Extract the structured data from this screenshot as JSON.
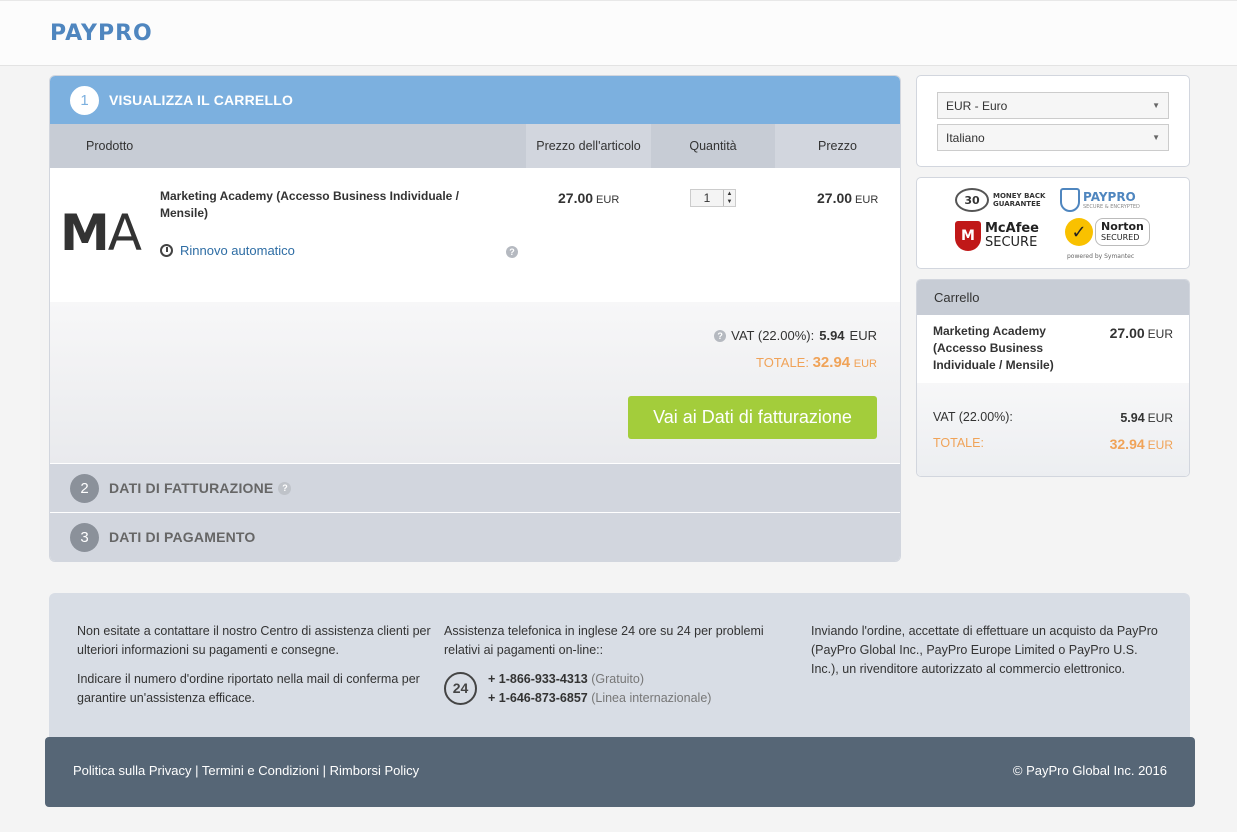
{
  "brand": {
    "logo": "PAYPRO",
    "color": "#4f86bf"
  },
  "steps": {
    "s1": {
      "num": "1",
      "title": "VISUALIZZA IL CARRELLO"
    },
    "s2": {
      "num": "2",
      "title": "DATI DI FATTURAZIONE"
    },
    "s3": {
      "num": "3",
      "title": "DATI DI PAGAMENTO"
    }
  },
  "table": {
    "headers": {
      "product": "Prodotto",
      "unit_price": "Prezzo dell'articolo",
      "qty": "Quantità",
      "price": "Prezzo"
    }
  },
  "item": {
    "logo_a": "M",
    "logo_b": "A",
    "name": "Marketing Academy (Accesso Business Individuale / Mensile)",
    "renew": "Rinnovo automatico",
    "unit_price": "27.00",
    "currency": "EUR",
    "quantity": "1",
    "price": "27.00"
  },
  "summary": {
    "vat_label": "VAT (22.00%):",
    "vat_value": "5.94",
    "total_label": "TOTALE:",
    "total_value": "32.94",
    "currency": "EUR",
    "cta": "Vai ai Dati di fatturazione"
  },
  "selects": {
    "currency": "EUR - Euro",
    "language": "Italiano"
  },
  "badges": {
    "days": "30",
    "money_back": "MONEY BACK",
    "guarantee": "GUARANTEE",
    "paypro": "PAYPRO",
    "paypro_sub": "SECURE & ENCRYPTED",
    "mcafee": "McAfee",
    "mcafee_secure": "SECURE",
    "norton": "Norton",
    "norton_secured": "SECURED",
    "powered": "powered by Symantec"
  },
  "cart": {
    "title": "Carrello",
    "item_name": "Marketing Academy (Accesso Business Individuale / Mensile)",
    "item_price": "27.00",
    "currency": "EUR",
    "vat_label": "VAT (22.00%):",
    "vat_value": "5.94",
    "total_label": "TOTALE:",
    "total_value": "32.94"
  },
  "info": {
    "col1_p1": "Non esitate a contattare il nostro Centro di assistenza clienti per ulteriori informazioni su pagamenti e consegne.",
    "col1_p2": "Indicare il numero d'ordine riportato nella mail di conferma per garantire un'assistenza efficace.",
    "col2_p1": "Assistenza telefonica in inglese 24 ore su 24 per problemi relativi ai pagamenti on-line::",
    "phone_badge": "24",
    "phone1": "+ 1-866-933-4313",
    "phone1_note": "(Gratuito)",
    "phone2": "+ 1-646-873-6857",
    "phone2_note": "(Linea internazionale)",
    "col3_p1": "Inviando l'ordine, accettate di effettuare un acquisto da PayPro (PayPro Global Inc., PayPro Europe Limited o PayPro U.S. Inc.), un rivenditore autorizzato al commercio elettronico."
  },
  "footer": {
    "privacy": "Politica sulla Privacy",
    "terms": "Termini e Condizioni",
    "refunds": "Rimborsi Policy",
    "separator": "|",
    "copyright": "© PayPro Global Inc. 2016"
  },
  "colors": {
    "accent_blue": "#7cb0df",
    "cta_green": "#a3cd3b",
    "total_orange": "#f0a358",
    "footer_bg": "#566676"
  }
}
